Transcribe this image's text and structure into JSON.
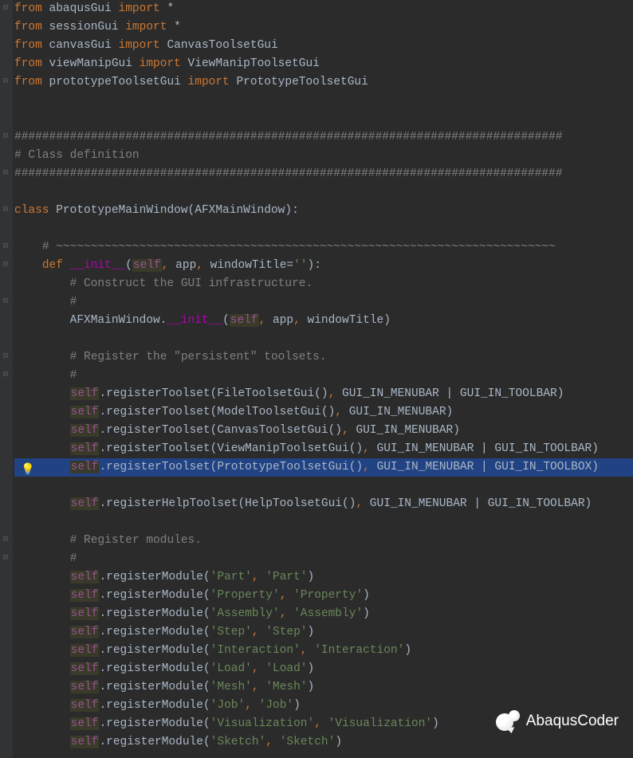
{
  "watermark": "AbaqusCoder",
  "bulb_line": 25,
  "highlighted_line": 25,
  "lines": [
    {
      "i": 0,
      "tokens": [
        [
          "kw-from",
          "from"
        ],
        [
          "name",
          " abaqusGui "
        ],
        [
          "kw-import",
          "import"
        ],
        [
          "name",
          " *"
        ]
      ]
    },
    {
      "i": 1,
      "tokens": [
        [
          "kw-from",
          "from"
        ],
        [
          "name",
          " sessionGui "
        ],
        [
          "kw-import",
          "import"
        ],
        [
          "name",
          " *"
        ]
      ]
    },
    {
      "i": 2,
      "tokens": [
        [
          "kw-from",
          "from"
        ],
        [
          "name",
          " canvasGui "
        ],
        [
          "kw-import",
          "import"
        ],
        [
          "name",
          " CanvasToolsetGui"
        ]
      ]
    },
    {
      "i": 3,
      "tokens": [
        [
          "kw-from",
          "from"
        ],
        [
          "name",
          " viewManipGui "
        ],
        [
          "kw-import",
          "import"
        ],
        [
          "name",
          " ViewManipToolsetGui"
        ]
      ]
    },
    {
      "i": 4,
      "tokens": [
        [
          "kw-from",
          "from"
        ],
        [
          "name",
          " prototypeToolsetGui "
        ],
        [
          "kw-import",
          "import"
        ],
        [
          "name",
          " PrototypeToolsetGui"
        ]
      ]
    },
    {
      "i": 5,
      "tokens": []
    },
    {
      "i": 6,
      "tokens": []
    },
    {
      "i": 7,
      "tokens": [
        [
          "comment",
          "###############################################################################"
        ]
      ]
    },
    {
      "i": 8,
      "tokens": [
        [
          "comment",
          "# Class definition"
        ]
      ]
    },
    {
      "i": 9,
      "tokens": [
        [
          "comment",
          "###############################################################################"
        ]
      ]
    },
    {
      "i": 10,
      "tokens": []
    },
    {
      "i": 11,
      "tokens": [
        [
          "kw-class",
          "class "
        ],
        [
          "name",
          "PrototypeMainWindow(AFXMainWindow):"
        ]
      ]
    },
    {
      "i": 12,
      "tokens": []
    },
    {
      "i": 13,
      "tokens": [
        [
          "name",
          "    "
        ],
        [
          "comment",
          "# ~~~~~~~~~~~~~~~~~~~~~~~~~~~~~~~~~~~~~~~~~~~~~~~~~~~~~~~~~~~~~~~~~~~~~~~~"
        ]
      ]
    },
    {
      "i": 14,
      "tokens": [
        [
          "name",
          "    "
        ],
        [
          "kw-def",
          "def "
        ],
        [
          "fn-name",
          "__init__"
        ],
        [
          "name",
          "("
        ],
        [
          "kw-self",
          "self"
        ],
        [
          "punct",
          ","
        ],
        [
          "name",
          " app"
        ],
        [
          "punct",
          ","
        ],
        [
          "name",
          " windowTitle="
        ],
        [
          "str",
          "''"
        ],
        [
          "name",
          "):"
        ]
      ]
    },
    {
      "i": 15,
      "tokens": [
        [
          "name",
          "        "
        ],
        [
          "comment",
          "# Construct the GUI infrastructure."
        ]
      ]
    },
    {
      "i": 16,
      "tokens": [
        [
          "name",
          "        "
        ],
        [
          "comment",
          "#"
        ]
      ]
    },
    {
      "i": 17,
      "tokens": [
        [
          "name",
          "        AFXMainWindow."
        ],
        [
          "fn-name",
          "__init__"
        ],
        [
          "name",
          "("
        ],
        [
          "kw-self",
          "self"
        ],
        [
          "punct",
          ","
        ],
        [
          "name",
          " app"
        ],
        [
          "punct",
          ","
        ],
        [
          "name",
          " windowTitle)"
        ]
      ]
    },
    {
      "i": 18,
      "tokens": []
    },
    {
      "i": 19,
      "tokens": [
        [
          "name",
          "        "
        ],
        [
          "comment",
          "# Register the \"persistent\" toolsets."
        ]
      ]
    },
    {
      "i": 20,
      "tokens": [
        [
          "name",
          "        "
        ],
        [
          "comment",
          "#"
        ]
      ]
    },
    {
      "i": 21,
      "tokens": [
        [
          "name",
          "        "
        ],
        [
          "kw-self",
          "self"
        ],
        [
          "name",
          ".registerToolset(FileToolsetGui()"
        ],
        [
          "punct",
          ","
        ],
        [
          "name",
          " GUI_IN_MENUBAR | GUI_IN_TOOLBAR)"
        ]
      ]
    },
    {
      "i": 22,
      "tokens": [
        [
          "name",
          "        "
        ],
        [
          "kw-self",
          "self"
        ],
        [
          "name",
          ".registerToolset(ModelToolsetGui()"
        ],
        [
          "punct",
          ","
        ],
        [
          "name",
          " GUI_IN_MENUBAR)"
        ]
      ]
    },
    {
      "i": 23,
      "tokens": [
        [
          "name",
          "        "
        ],
        [
          "kw-self",
          "self"
        ],
        [
          "name",
          ".registerToolset(CanvasToolsetGui()"
        ],
        [
          "punct",
          ","
        ],
        [
          "name",
          " GUI_IN_MENUBAR)"
        ]
      ]
    },
    {
      "i": 24,
      "tokens": [
        [
          "name",
          "        "
        ],
        [
          "kw-self",
          "self"
        ],
        [
          "name",
          ".registerToolset(ViewManipToolsetGui()"
        ],
        [
          "punct",
          ","
        ],
        [
          "name",
          " GUI_IN_MENUBAR | GUI_IN_TOOLBAR)"
        ]
      ]
    },
    {
      "i": 25,
      "tokens": [
        [
          "name",
          "        "
        ],
        [
          "kw-self-h",
          "self"
        ],
        [
          "name",
          ".registerToolset(PrototypeToolsetGui()"
        ],
        [
          "punct",
          ","
        ],
        [
          "name",
          " GUI_IN_MENUBAR | GUI_IN_TOOLBOX)"
        ]
      ]
    },
    {
      "i": 26,
      "tokens": []
    },
    {
      "i": 27,
      "tokens": [
        [
          "name",
          "        "
        ],
        [
          "kw-self",
          "self"
        ],
        [
          "name",
          ".registerHelpToolset(HelpToolsetGui()"
        ],
        [
          "punct",
          ","
        ],
        [
          "name",
          " GUI_IN_MENUBAR | GUI_IN_TOOLBAR)"
        ]
      ]
    },
    {
      "i": 28,
      "tokens": []
    },
    {
      "i": 29,
      "tokens": [
        [
          "name",
          "        "
        ],
        [
          "comment",
          "# Register modules."
        ]
      ]
    },
    {
      "i": 30,
      "tokens": [
        [
          "name",
          "        "
        ],
        [
          "comment",
          "#"
        ]
      ]
    },
    {
      "i": 31,
      "tokens": [
        [
          "name",
          "        "
        ],
        [
          "kw-self",
          "self"
        ],
        [
          "name",
          ".registerModule("
        ],
        [
          "str",
          "'Part'"
        ],
        [
          "punct",
          ","
        ],
        [
          "name",
          " "
        ],
        [
          "str",
          "'Part'"
        ],
        [
          "name",
          ")"
        ]
      ]
    },
    {
      "i": 32,
      "tokens": [
        [
          "name",
          "        "
        ],
        [
          "kw-self",
          "self"
        ],
        [
          "name",
          ".registerModule("
        ],
        [
          "str",
          "'Property'"
        ],
        [
          "punct",
          ","
        ],
        [
          "name",
          " "
        ],
        [
          "str",
          "'Property'"
        ],
        [
          "name",
          ")"
        ]
      ]
    },
    {
      "i": 33,
      "tokens": [
        [
          "name",
          "        "
        ],
        [
          "kw-self",
          "self"
        ],
        [
          "name",
          ".registerModule("
        ],
        [
          "str",
          "'Assembly'"
        ],
        [
          "punct",
          ","
        ],
        [
          "name",
          " "
        ],
        [
          "str",
          "'Assembly'"
        ],
        [
          "name",
          ")"
        ]
      ]
    },
    {
      "i": 34,
      "tokens": [
        [
          "name",
          "        "
        ],
        [
          "kw-self",
          "self"
        ],
        [
          "name",
          ".registerModule("
        ],
        [
          "str",
          "'Step'"
        ],
        [
          "punct",
          ","
        ],
        [
          "name",
          " "
        ],
        [
          "str",
          "'Step'"
        ],
        [
          "name",
          ")"
        ]
      ]
    },
    {
      "i": 35,
      "tokens": [
        [
          "name",
          "        "
        ],
        [
          "kw-self",
          "self"
        ],
        [
          "name",
          ".registerModule("
        ],
        [
          "str",
          "'Interaction'"
        ],
        [
          "punct",
          ","
        ],
        [
          "name",
          " "
        ],
        [
          "str",
          "'Interaction'"
        ],
        [
          "name",
          ")"
        ]
      ]
    },
    {
      "i": 36,
      "tokens": [
        [
          "name",
          "        "
        ],
        [
          "kw-self",
          "self"
        ],
        [
          "name",
          ".registerModule("
        ],
        [
          "str",
          "'Load'"
        ],
        [
          "punct",
          ","
        ],
        [
          "name",
          " "
        ],
        [
          "str",
          "'Load'"
        ],
        [
          "name",
          ")"
        ]
      ]
    },
    {
      "i": 37,
      "tokens": [
        [
          "name",
          "        "
        ],
        [
          "kw-self",
          "self"
        ],
        [
          "name",
          ".registerModule("
        ],
        [
          "str",
          "'Mesh'"
        ],
        [
          "punct",
          ","
        ],
        [
          "name",
          " "
        ],
        [
          "str",
          "'Mesh'"
        ],
        [
          "name",
          ")"
        ]
      ]
    },
    {
      "i": 38,
      "tokens": [
        [
          "name",
          "        "
        ],
        [
          "kw-self",
          "self"
        ],
        [
          "name",
          ".registerModule("
        ],
        [
          "str",
          "'Job'"
        ],
        [
          "punct",
          ","
        ],
        [
          "name",
          " "
        ],
        [
          "str",
          "'Job'"
        ],
        [
          "name",
          ")"
        ]
      ]
    },
    {
      "i": 39,
      "tokens": [
        [
          "name",
          "        "
        ],
        [
          "kw-self",
          "self"
        ],
        [
          "name",
          ".registerModule("
        ],
        [
          "str",
          "'Visualization'"
        ],
        [
          "punct",
          ","
        ],
        [
          "name",
          " "
        ],
        [
          "str",
          "'Visualization'"
        ],
        [
          "name",
          ")"
        ]
      ]
    },
    {
      "i": 40,
      "tokens": [
        [
          "name",
          "        "
        ],
        [
          "kw-self",
          "self"
        ],
        [
          "name",
          ".registerModule("
        ],
        [
          "str",
          "'Sketch'"
        ],
        [
          "punct",
          ","
        ],
        [
          "name",
          " "
        ],
        [
          "str",
          "'Sketch'"
        ],
        [
          "name",
          ")"
        ]
      ]
    }
  ],
  "folds": [
    0,
    4,
    7,
    9,
    11,
    13,
    14,
    16,
    19,
    20,
    29,
    30
  ]
}
